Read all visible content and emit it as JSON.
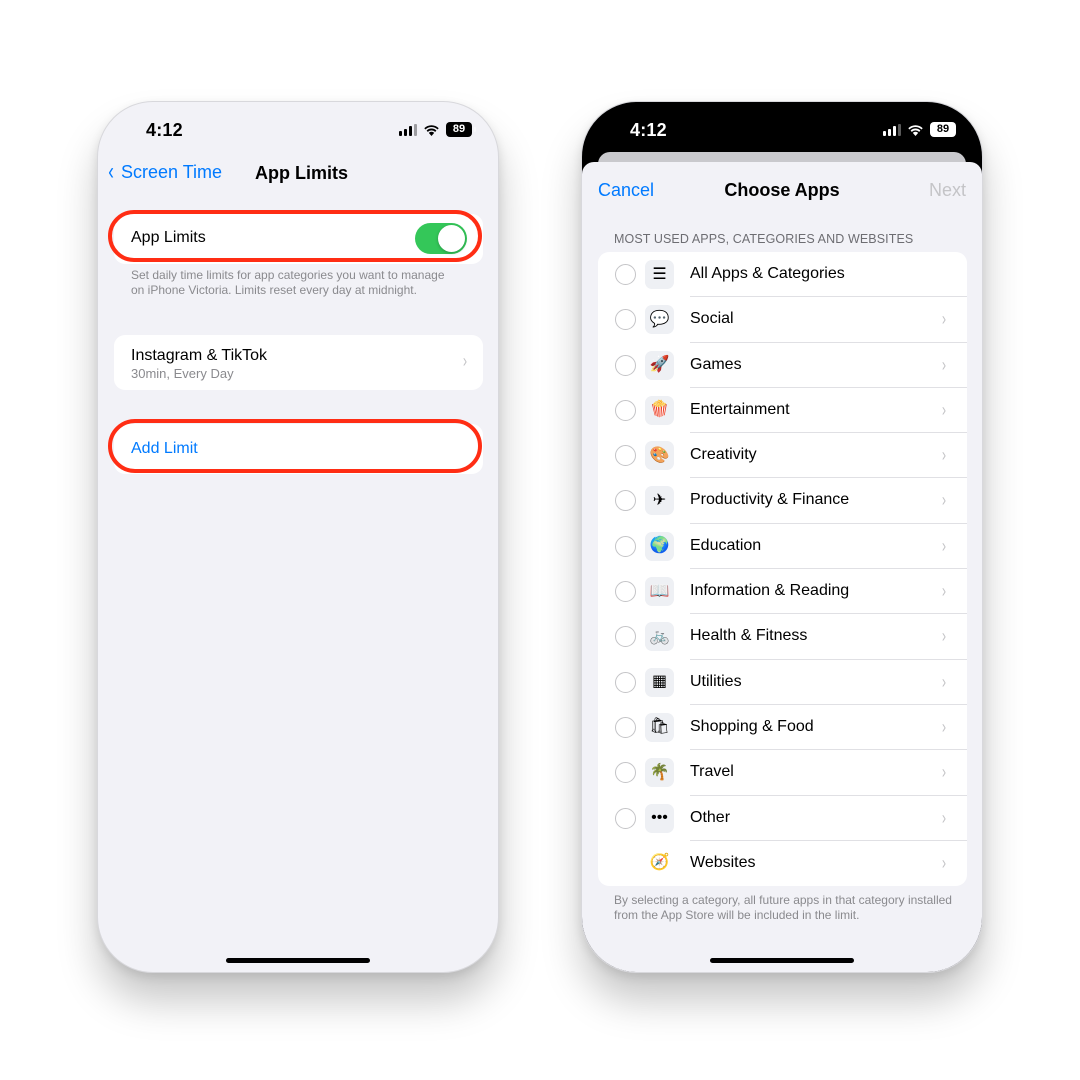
{
  "left_phone": {
    "status_bar": {
      "time": "4:12",
      "battery": "89"
    },
    "nav": {
      "back_label": "Screen Time",
      "title": "App Limits"
    },
    "toggle": {
      "label": "App Limits",
      "on": true
    },
    "footnote": "Set daily time limits for app categories you want to manage on iPhone Victoria. Limits reset every day at midnight.",
    "limit": {
      "title": "Instagram & TikTok",
      "subtitle": "30min, Every Day"
    },
    "add_limit_label": "Add Limit"
  },
  "right_phone": {
    "status_bar": {
      "time": "4:12",
      "battery": "89"
    },
    "nav": {
      "cancel_label": "Cancel",
      "title": "Choose Apps",
      "next_label": "Next"
    },
    "section_header": "MOST USED APPS, CATEGORIES AND WEBSITES",
    "categories": [
      {
        "label": "All Apps & Categories",
        "icon": "stack-icon",
        "glyph": "☰"
      },
      {
        "label": "Social",
        "icon": "speech-heart-icon",
        "glyph": "💬"
      },
      {
        "label": "Games",
        "icon": "rocket-icon",
        "glyph": "🚀"
      },
      {
        "label": "Entertainment",
        "icon": "popcorn-icon",
        "glyph": "🍿"
      },
      {
        "label": "Creativity",
        "icon": "palette-icon",
        "glyph": "🎨"
      },
      {
        "label": "Productivity & Finance",
        "icon": "paper-plane-icon",
        "glyph": "✈"
      },
      {
        "label": "Education",
        "icon": "globe-icon",
        "glyph": "🌍"
      },
      {
        "label": "Information & Reading",
        "icon": "book-icon",
        "glyph": "📖"
      },
      {
        "label": "Health & Fitness",
        "icon": "bicycle-icon",
        "glyph": "🚲"
      },
      {
        "label": "Utilities",
        "icon": "calculator-icon",
        "glyph": "▦"
      },
      {
        "label": "Shopping & Food",
        "icon": "shopping-bag-icon",
        "glyph": "🛍"
      },
      {
        "label": "Travel",
        "icon": "palm-tree-icon",
        "glyph": "🌴"
      },
      {
        "label": "Other",
        "icon": "ellipsis-icon",
        "glyph": "•••"
      },
      {
        "label": "Websites",
        "icon": "compass-icon",
        "glyph": "🧭"
      }
    ],
    "footnote": "By selecting a category, all future apps in that category installed from the App Store will be included in the limit."
  },
  "colors": {
    "accent": "#007aff",
    "toggle_on": "#34c759",
    "highlight": "#ff2d14"
  }
}
